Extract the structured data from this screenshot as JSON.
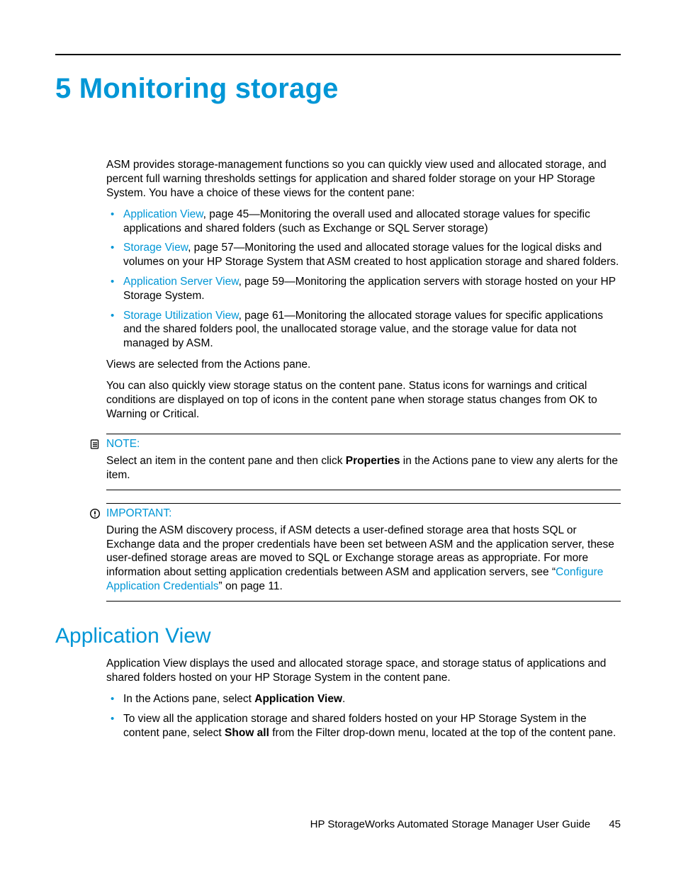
{
  "chapter": {
    "number": "5",
    "title": "Monitoring storage"
  },
  "intro": "ASM provides storage-management functions so you can quickly view used and allocated storage, and percent full warning thresholds settings for application and shared folder storage on your HP Storage System. You have a choice of these views for the content pane:",
  "views": [
    {
      "link": "Application View",
      "rest": ", page 45—Monitoring the overall used and allocated storage values for specific applications and shared folders (such as Exchange or SQL Server storage)"
    },
    {
      "link": "Storage View",
      "rest": ", page 57—Monitoring the used and allocated storage values for the logical disks and volumes on your HP Storage System that ASM created to host application storage and shared folders."
    },
    {
      "link": "Application Server View",
      "rest": ", page 59—Monitoring the application servers with storage hosted on your HP Storage System."
    },
    {
      "link": "Storage Utilization View",
      "rest": ", page 61—Monitoring the allocated storage values for specific applications and the shared folders pool, the unallocated storage value, and the storage value for data not managed by ASM."
    }
  ],
  "after_list_1": "Views are selected from the Actions pane.",
  "after_list_2": "You can also quickly view storage status on the content pane. Status icons for warnings and critical conditions are displayed on top of icons in the content pane when storage status changes from OK to Warning or Critical.",
  "note": {
    "label": "NOTE:",
    "pre": "Select an item in the content pane and then click ",
    "bold": "Properties",
    "post": " in the Actions pane to view any alerts for the item."
  },
  "important": {
    "label": "IMPORTANT:",
    "pre": "During the ASM discovery process, if ASM detects a user-defined storage area that hosts SQL or Exchange data and the proper credentials have been set between ASM and the application server, these user-defined storage areas are moved to SQL or Exchange storage areas as appropriate. For more information about setting application credentials between ASM and application servers, see “",
    "link": "Configure Application Credentials",
    "post": "” on page 11."
  },
  "section": {
    "title": "Application View",
    "p1": "Application View displays the used and allocated storage space, and storage status of applications and shared folders hosted on your HP Storage System in the content pane.",
    "bullets": [
      {
        "pre": "In the Actions pane, select ",
        "bold": "Application View",
        "post": "."
      },
      {
        "pre": "To view all the application storage and shared folders hosted on your HP Storage System in the content pane, select ",
        "bold": "Show all",
        "post": " from the Filter drop-down menu, located at the top of the content pane."
      }
    ]
  },
  "footer": {
    "title": "HP StorageWorks Automated Storage Manager User Guide",
    "page": "45"
  }
}
